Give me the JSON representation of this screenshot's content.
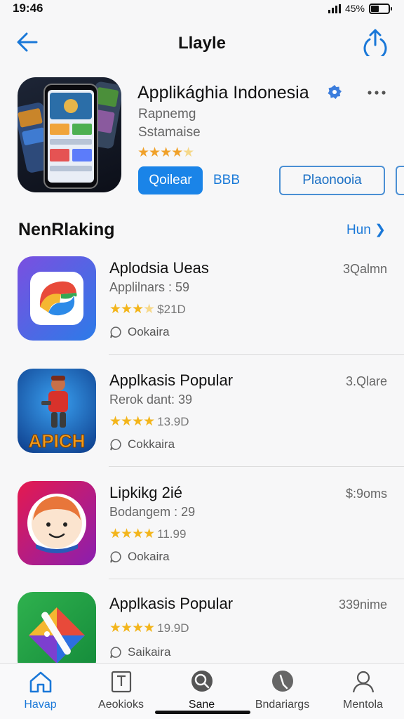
{
  "status_bar": {
    "time": "19:46",
    "battery_label": "45%",
    "battery_level": 0.45,
    "icons": [
      "signal-icon",
      "battery-icon"
    ]
  },
  "nav": {
    "title": "Llayle",
    "back_icon": "back-arrow-icon",
    "share_icon": "share-icon"
  },
  "app": {
    "title": "Applikághia Indonesia",
    "subtitle_1": "Rapnemg",
    "subtitle_2": "Sstamaise",
    "rating_stars": 4,
    "get_label": "Qoilear",
    "price_label": "BBB",
    "secondary_label": "Plaonooia",
    "colors": {
      "accent": "#1a84e8",
      "star": "#f3b51b"
    }
  },
  "section": {
    "title": "NenRlaking",
    "link_label": "Hun"
  },
  "apps": [
    {
      "name": "Aplodsia Ueas",
      "subtitle": "Applilnars : 59",
      "rating_stars": 3.5,
      "rating_text": "$21D",
      "size": "3Qalmn",
      "category": "Ookaira",
      "icon": "swirl-app-icon",
      "icon_color": "#4f6ff0"
    },
    {
      "name": "Applkasis Popular",
      "subtitle": "Rerok dant: 39",
      "rating_stars": 4,
      "rating_text": "13.9D",
      "size": "3.Qlare",
      "category": "Cokkaira",
      "icon": "game-character-app-icon",
      "icon_color": "#1a4ea8",
      "icon_text": "APICH"
    },
    {
      "name": "Lipkikg 2ié",
      "subtitle": "Bodangem : 29",
      "rating_stars": 4,
      "rating_text": "11.99",
      "size": "$:9oms",
      "category": "Ookaira",
      "icon": "face-app-icon",
      "icon_color": "#d81b60"
    },
    {
      "name": "Applkasis Popular",
      "subtitle": "",
      "rating_stars": 4,
      "rating_text": "19.9D",
      "size": "339nime",
      "category": "Saikaira",
      "icon": "paint-app-icon",
      "icon_color": "#27a844"
    }
  ],
  "tabs": [
    {
      "label": "Havap",
      "icon": "home-icon",
      "active": true
    },
    {
      "label": "Aeokioks",
      "icon": "book-icon",
      "active": false
    },
    {
      "label": "Sane",
      "icon": "search-icon",
      "active": false
    },
    {
      "label": "Bndariargs",
      "icon": "search-icon",
      "active": false
    },
    {
      "label": "Mentola",
      "icon": "person-icon",
      "active": false
    }
  ]
}
